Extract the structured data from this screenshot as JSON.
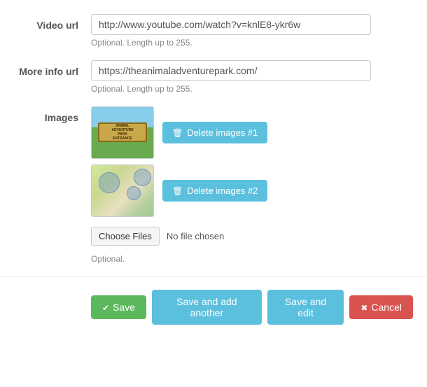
{
  "form": {
    "video_url": {
      "label": "Video url",
      "value": "http://www.youtube.com/watch?v=knlE8-ykr6w",
      "hint": "Optional. Length up to 255."
    },
    "more_info_url": {
      "label": "More info url",
      "value": "https://theanimaladventurepark.com/",
      "hint": "Optional. Length up to 255."
    },
    "images": {
      "label": "Images",
      "hint": "Optional.",
      "no_file_text": "No file chosen",
      "image1": {
        "alt": "Animal Adventure Park entrance",
        "delete_label": "Delete images #1"
      },
      "image2": {
        "alt": "Animal Adventure Park map",
        "delete_label": "Delete images #2"
      },
      "choose_files_label": "Choose Files"
    }
  },
  "footer": {
    "save_label": "Save",
    "save_add_label": "Save and add another",
    "save_edit_label": "Save and edit",
    "cancel_label": "Cancel"
  }
}
